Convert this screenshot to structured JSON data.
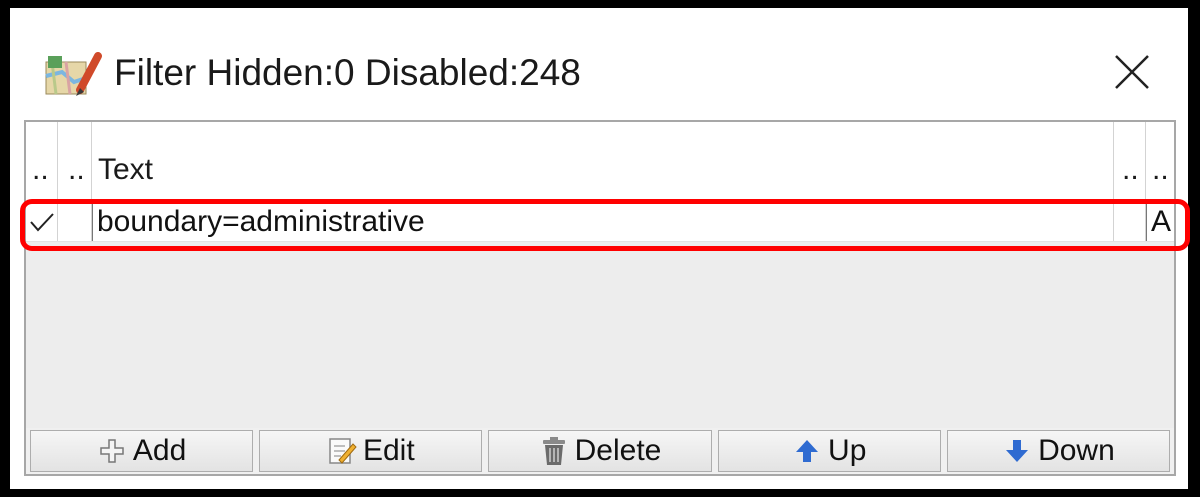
{
  "window": {
    "title": "Filter Hidden:0 Disabled:248",
    "app_icon": "josm-map-icon",
    "close_icon": "close-icon"
  },
  "table": {
    "headers": [
      "..",
      "..",
      "Text",
      "..",
      ".."
    ],
    "rows": [
      {
        "enabled": true,
        "hidden": false,
        "text": "boundary=administrative",
        "inverted": "",
        "mode": "A"
      }
    ]
  },
  "buttons": [
    {
      "label": "Add",
      "icon": "plus-icon"
    },
    {
      "label": "Edit",
      "icon": "edit-pencil-icon"
    },
    {
      "label": "Delete",
      "icon": "trash-icon"
    },
    {
      "label": "Up",
      "icon": "arrow-up-icon"
    },
    {
      "label": "Down",
      "icon": "arrow-down-icon"
    }
  ],
  "colors": {
    "highlight": "#ff0000",
    "arrow_blue": "#2f6bd1"
  }
}
